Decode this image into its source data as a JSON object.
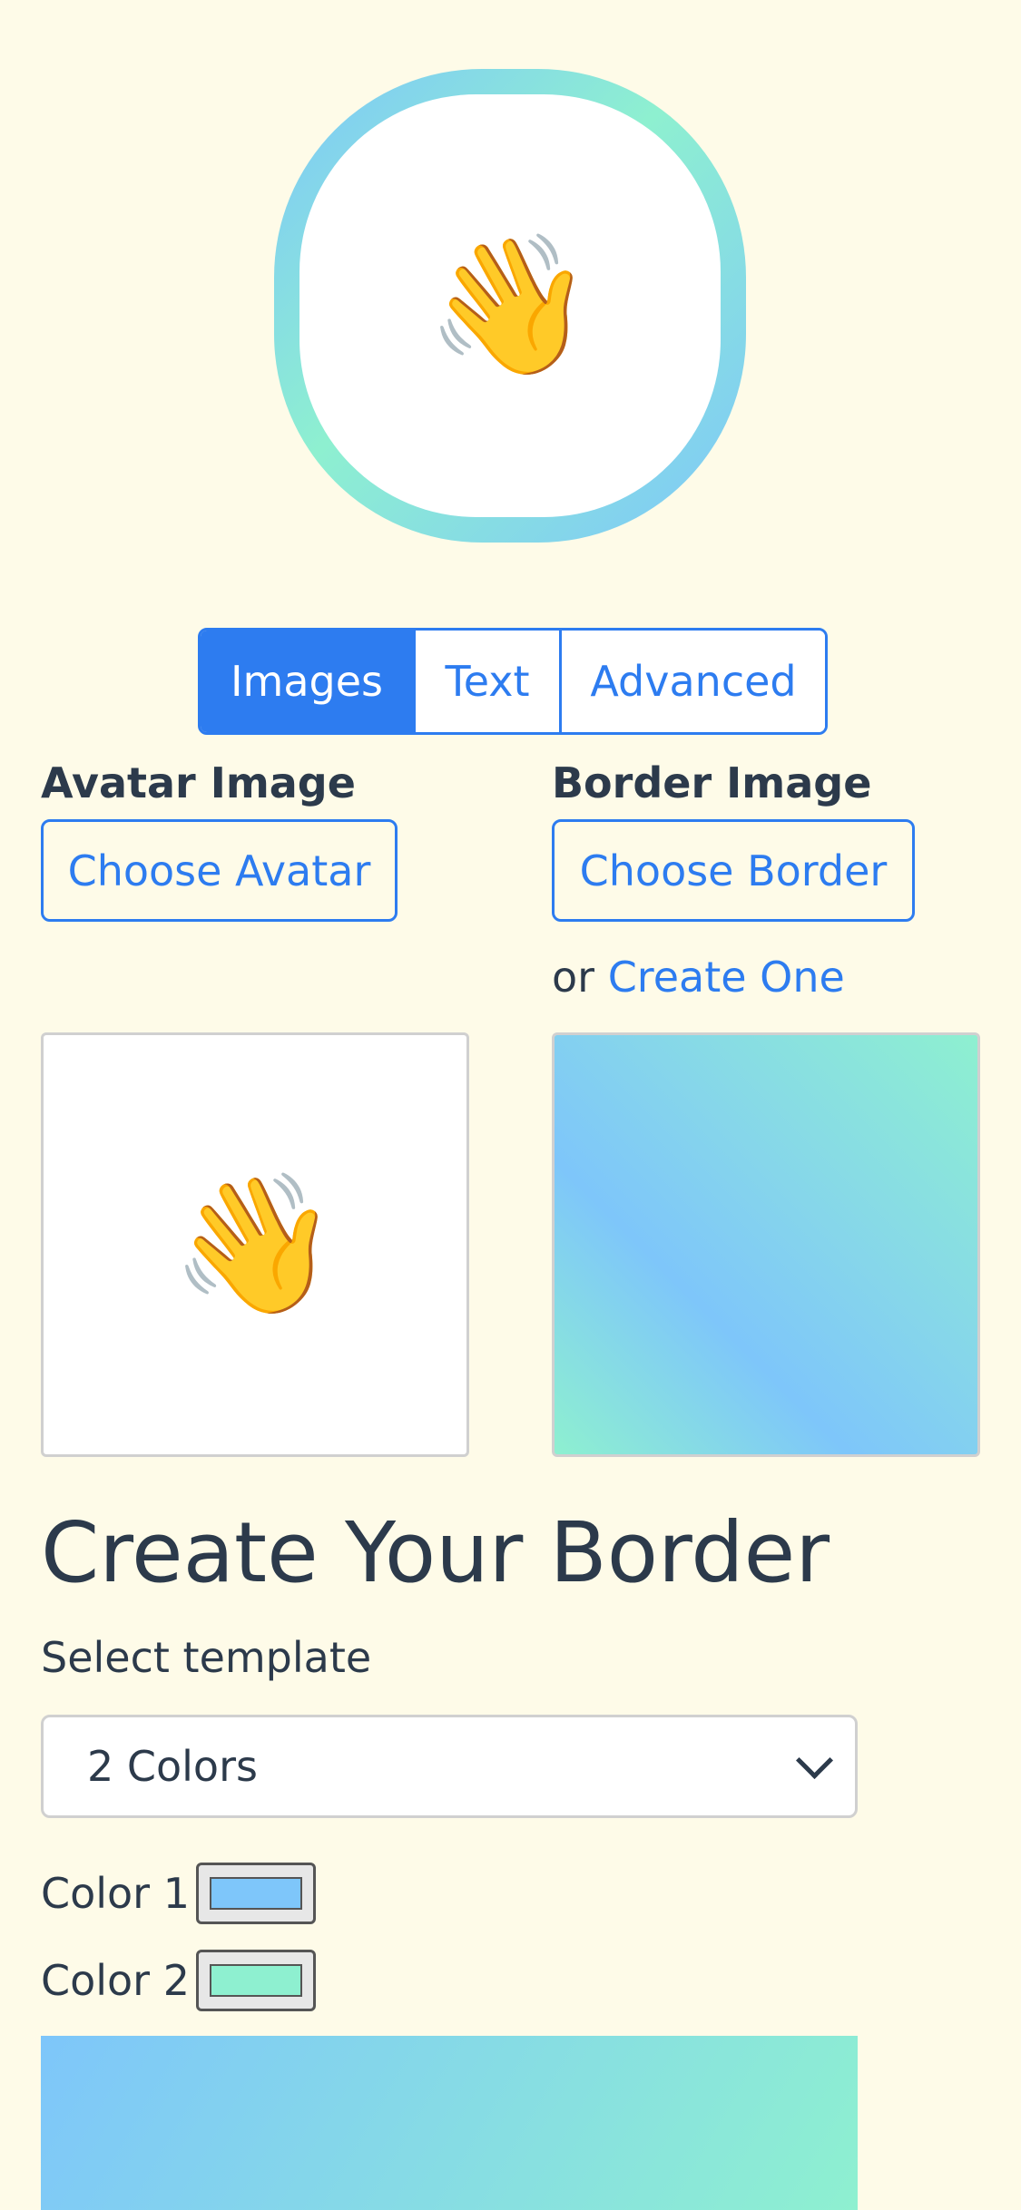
{
  "preview": {
    "emoji": "👋"
  },
  "tabs": [
    {
      "label": "Images",
      "active": true
    },
    {
      "label": "Text",
      "active": false
    },
    {
      "label": "Advanced",
      "active": false
    }
  ],
  "avatar": {
    "label": "Avatar Image",
    "button": "Choose Avatar",
    "emoji": "👋"
  },
  "border": {
    "label": "Border Image",
    "button": "Choose Border",
    "or_text": "or",
    "create_link": "Create One"
  },
  "create": {
    "heading": "Create Your Border",
    "select_label": "Select template",
    "select_value": "2 Colors",
    "color1_label": "Color 1",
    "color2_label": "Color 2",
    "color1": "#7ec6fa",
    "color2": "#8ef0d0"
  },
  "theme": {
    "accent": "#2d7cf0",
    "background": "#fefbe8",
    "text": "#2c3a4b"
  }
}
